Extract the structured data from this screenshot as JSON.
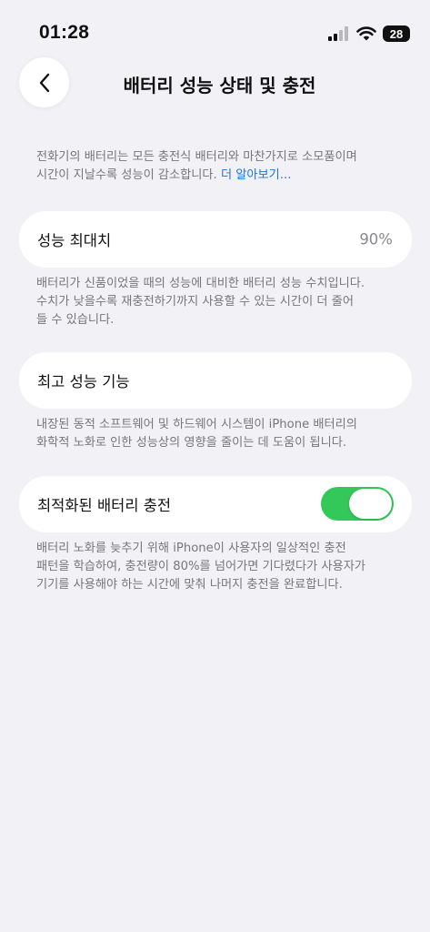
{
  "status": {
    "time": "01:28",
    "battery": "28"
  },
  "nav": {
    "title": "배터리 성능 상태 및 충전"
  },
  "intro": {
    "text": "전화기의 배터리는 모든 충전식 배터리와 마찬가지로 소모품이며\n시간이 지날수록 성능이 감소합니다. ",
    "link": "더 알아보기..."
  },
  "max_capacity": {
    "label": "성능 최대치",
    "value": "90%",
    "caption": "배터리가 신품이었을 때의 성능에 대비한 배터리 성능 수치입니다.\n수치가 낮을수록 재충전하기까지 사용할 수 있는 시간이 더 줄어\n들 수 있습니다."
  },
  "peak_performance": {
    "label": "최고 성능 기능",
    "caption": "내장된 동적 소프트웨어 및 하드웨어 시스템이 iPhone 배터리의\n화학적 노화로 인한 성능상의 영향을 줄이는 데 도움이 됩니다."
  },
  "optimized_charging": {
    "label": "최적화된 배터리 충전",
    "enabled": true,
    "caption": "배터리 노화를 늦추기 위해 iPhone이 사용자의 일상적인 충전\n패턴을 학습하여, 충전량이 80%를 넘어가면 기다렸다가 사용자가\n기기를 사용해야 하는 시간에 맞춰 나머지 충전을 완료합니다."
  },
  "colors": {
    "background": "#f2f1f6",
    "toggle_on": "#34c759",
    "link": "#1a73e8",
    "caption": "#77767c"
  },
  "icons": {
    "signal": "cellular-signal-icon",
    "wifi": "wifi-icon",
    "battery": "battery-icon",
    "back": "chevron-left-icon"
  }
}
